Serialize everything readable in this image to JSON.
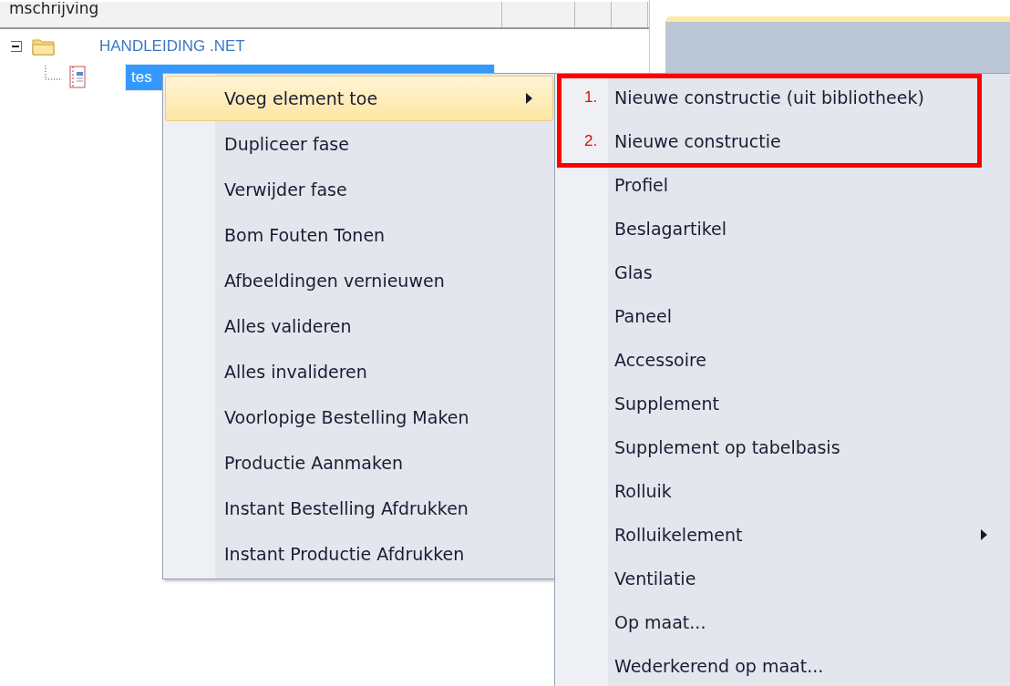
{
  "tree": {
    "header": "mschrijving",
    "rows": [
      {
        "label": "HANDLEIDING .NET",
        "kind": "folder",
        "expanded": true,
        "children": [
          {
            "label": "tes",
            "kind": "document",
            "selected": true
          }
        ]
      }
    ]
  },
  "context_menu": {
    "items": [
      {
        "label": "Voeg element toe",
        "selected": true,
        "submenu": true
      },
      {
        "label": "Dupliceer fase",
        "selected": false,
        "submenu": false
      },
      {
        "label": "Verwijder fase",
        "selected": false,
        "submenu": false
      },
      {
        "label": "Bom Fouten Tonen",
        "selected": false,
        "submenu": false
      },
      {
        "label": "Afbeeldingen vernieuwen",
        "selected": false,
        "submenu": false
      },
      {
        "label": "Alles valideren",
        "selected": false,
        "submenu": false
      },
      {
        "label": "Alles invalideren",
        "selected": false,
        "submenu": false
      },
      {
        "label": "Voorlopige Bestelling Maken",
        "selected": false,
        "submenu": false
      },
      {
        "label": "Productie Aanmaken",
        "selected": false,
        "submenu": false
      },
      {
        "label": "Instant Bestelling Afdrukken",
        "selected": false,
        "submenu": false
      },
      {
        "label": "Instant Productie Afdrukken",
        "selected": false,
        "submenu": false
      }
    ]
  },
  "submenu": {
    "items": [
      {
        "label": "Nieuwe constructie (uit bibliotheek)",
        "marker": "1.",
        "highlighted": true,
        "submenu": false
      },
      {
        "label": "Nieuwe constructie",
        "marker": "2.",
        "highlighted": true,
        "submenu": false
      },
      {
        "label": "Profiel",
        "highlighted": false,
        "submenu": false
      },
      {
        "label": "Beslagartikel",
        "highlighted": false,
        "submenu": false
      },
      {
        "label": "Glas",
        "highlighted": false,
        "submenu": false
      },
      {
        "label": "Paneel",
        "highlighted": false,
        "submenu": false
      },
      {
        "label": "Accessoire",
        "highlighted": false,
        "submenu": false
      },
      {
        "label": "Supplement",
        "highlighted": false,
        "submenu": false
      },
      {
        "label": "Supplement op tabelbasis",
        "highlighted": false,
        "submenu": false
      },
      {
        "label": "Rolluik",
        "highlighted": false,
        "submenu": false
      },
      {
        "label": "Rolluikelement",
        "highlighted": false,
        "submenu": true
      },
      {
        "label": "Ventilatie",
        "highlighted": false,
        "submenu": false
      },
      {
        "label": "Op maat...",
        "highlighted": false,
        "submenu": false
      },
      {
        "label": "Wederkerend op maat...",
        "highlighted": false,
        "submenu": false
      }
    ]
  }
}
